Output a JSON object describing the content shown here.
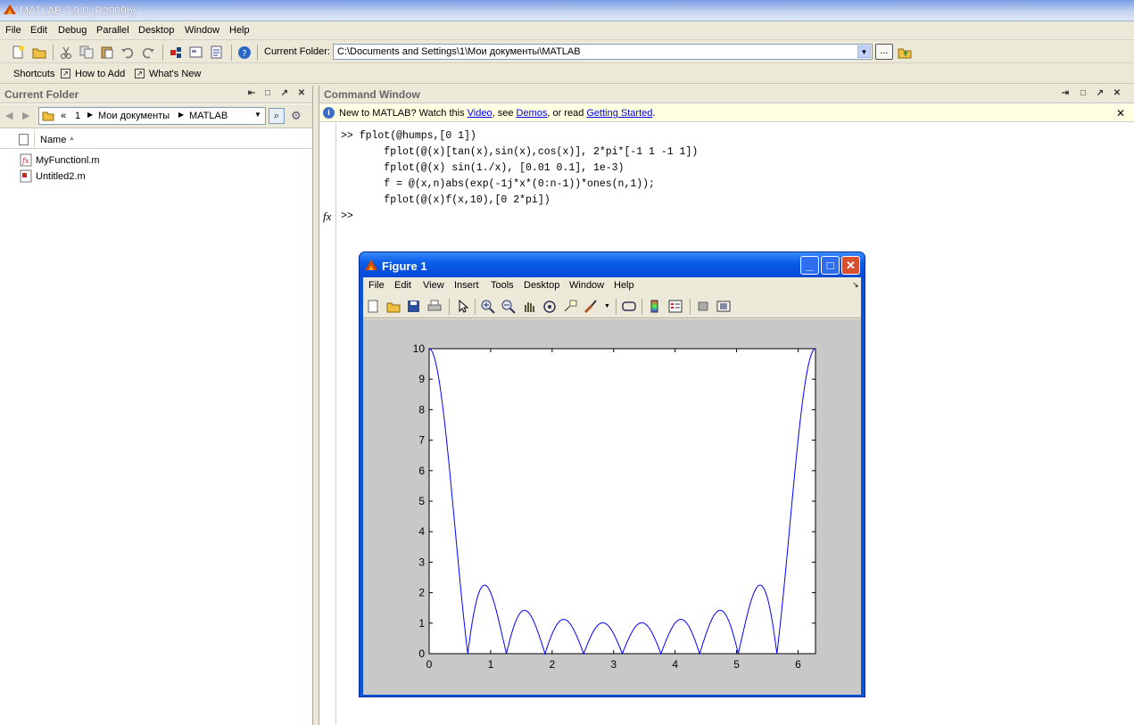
{
  "app": {
    "title": "MATLAB  7.9.0 (R2009b)"
  },
  "menu": [
    "File",
    "Edit",
    "Debug",
    "Parallel",
    "Desktop",
    "Window",
    "Help"
  ],
  "toolbar": {
    "current_folder_label": "Current Folder:",
    "current_folder_path": "C:\\Documents and Settings\\1\\Мои документы\\MATLAB",
    "browse_label": "..."
  },
  "shortcuts": {
    "shortcuts_label": "Shortcuts",
    "how_to_add": "How to Add",
    "whats_new": "What's New"
  },
  "left_panel": {
    "title": "Current Folder",
    "path_parts": [
      "«",
      "1",
      "Мои документы",
      "MATLAB"
    ],
    "column_name": "Name",
    "files": [
      "MyFunctionl.m",
      "Untitled2.m"
    ]
  },
  "command_window": {
    "title": "Command Window",
    "info": {
      "prefix": "New to MATLAB? Watch this ",
      "video": "Video",
      "mid1": ", see ",
      "demos": "Demos",
      "mid2": ", or read ",
      "getting_started": "Getting Started",
      "suffix": "."
    },
    "lines": [
      ">> fplot(@humps,[0 1])",
      "       fplot(@(x)[tan(x),sin(x),cos(x)], 2*pi*[-1 1 -1 1])",
      "       fplot(@(x) sin(1./x), [0.01 0.1], 1e-3)",
      "       f = @(x,n)abs(exp(-1j*x*(0:n-1))*ones(n,1));",
      "       fplot(@(x)f(x,10),[0 2*pi])"
    ],
    "prompt": ">>",
    "fx": "fx"
  },
  "figure": {
    "title": "Figure 1",
    "menu": [
      "File",
      "Edit",
      "View",
      "Insert",
      "Tools",
      "Desktop",
      "Window",
      "Help"
    ]
  },
  "chart_data": {
    "type": "line",
    "xlim": [
      0,
      6.283
    ],
    "ylim": [
      0,
      10
    ],
    "xticks": [
      0,
      1,
      2,
      3,
      4,
      5,
      6
    ],
    "yticks": [
      0,
      1,
      2,
      3,
      4,
      5,
      6,
      7,
      8,
      9,
      10
    ],
    "series": [
      {
        "function": "abs(sum_{k=0}^{9} exp(-1j*x*k))",
        "x_range": [
          0,
          6.283
        ],
        "color": "#0000ff"
      }
    ],
    "grid": false,
    "title": "",
    "xlabel": "",
    "ylabel": ""
  }
}
